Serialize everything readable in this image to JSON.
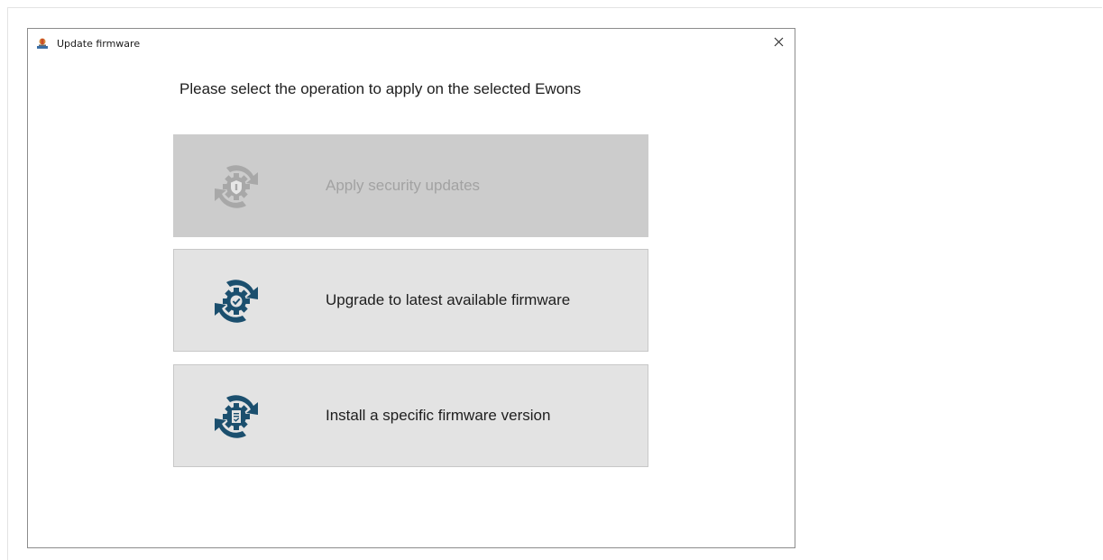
{
  "window": {
    "title": "Update firmware",
    "close_glyph": "✕"
  },
  "prompt": "Please select the operation to apply on the selected Ewons",
  "operations": [
    {
      "label": "Apply security updates",
      "icon": "security-update-gear-icon",
      "enabled": false
    },
    {
      "label": "Upgrade to latest available firmware",
      "icon": "upgrade-gear-check-icon",
      "enabled": true
    },
    {
      "label": "Install a specific firmware version",
      "icon": "install-gear-file-icon",
      "enabled": true
    }
  ],
  "colors": {
    "icon_active": "#1b4f6e",
    "icon_disabled": "#a8a8a8",
    "button_bg": "#e3e3e3",
    "button_disabled_bg": "#cccccc"
  }
}
